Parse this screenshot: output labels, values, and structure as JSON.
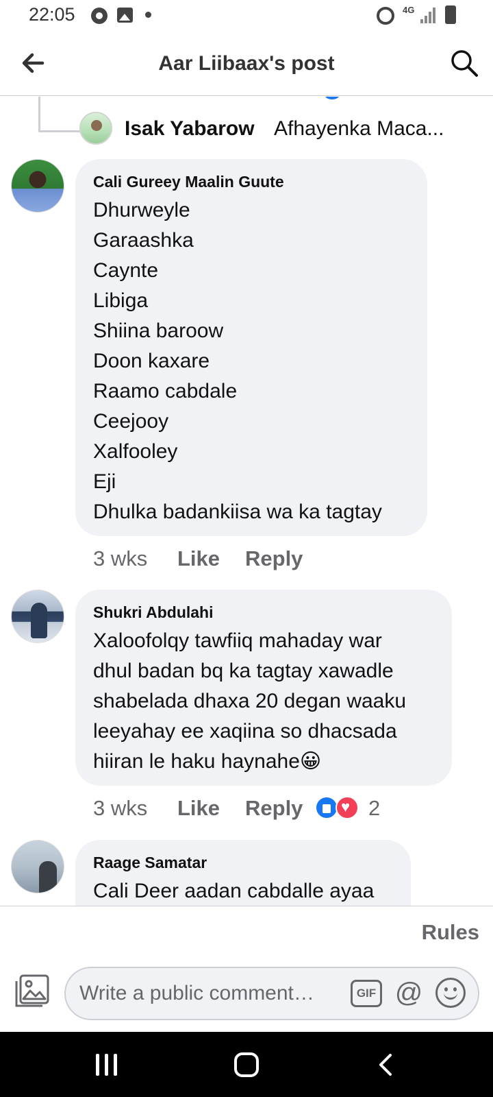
{
  "status_bar": {
    "time": "22:05",
    "network": "4G",
    "icons": [
      "chrome-icon",
      "gallery-icon",
      "notification-dot-icon",
      "alarm-icon",
      "network-4g-icon",
      "signal-icon",
      "battery-icon"
    ]
  },
  "header": {
    "title": "Aar Liibaax's post",
    "back_icon": "arrow-left-icon",
    "search_icon": "search-icon"
  },
  "collapsed_reply": {
    "author": "Isak Yabarow",
    "text": "Afhayenka Maca..."
  },
  "comments": [
    {
      "author": "Cali Gureey Maalin Guute",
      "lines": [
        "Dhurweyle",
        "Garaashka",
        "Caynte",
        "Libiga",
        "Shiina baroow",
        "Doon kaxare",
        "Raamo cabdale",
        "Ceejooy",
        "Xalfooley",
        "Eji",
        "Dhulka badankiisa wa ka tagtay"
      ],
      "time": "3 wks",
      "like": "Like",
      "reply": "Reply"
    },
    {
      "author": "Shukri Abdulahi",
      "lines": [
        "Xaloofolqy tawfiiq mahaday war",
        "dhul badan bq ka tagtay xawadle",
        "shabelada dhaxa 20 degan waaku",
        "leeyahay ee xaqiina so dhacsada",
        "hiiran le haku haynahe😀"
      ],
      "time": "3 wks",
      "like": "Like",
      "reply": "Reply",
      "reactions": [
        "like",
        "love"
      ],
      "reaction_count": "2"
    },
    {
      "author": "Raage Samatar",
      "lines": [
        "Cali Deer aadan cabdalle ayaa"
      ]
    }
  ],
  "footer": {
    "rules": "Rules",
    "comment_placeholder": "Write a public comment…",
    "gif_label": "GIF",
    "mention_label": "@"
  },
  "colors": {
    "bubble": "#f0f2f5",
    "secondary_text": "#65676b",
    "like_blue": "#1877f2",
    "love_red": "#f33e58"
  }
}
